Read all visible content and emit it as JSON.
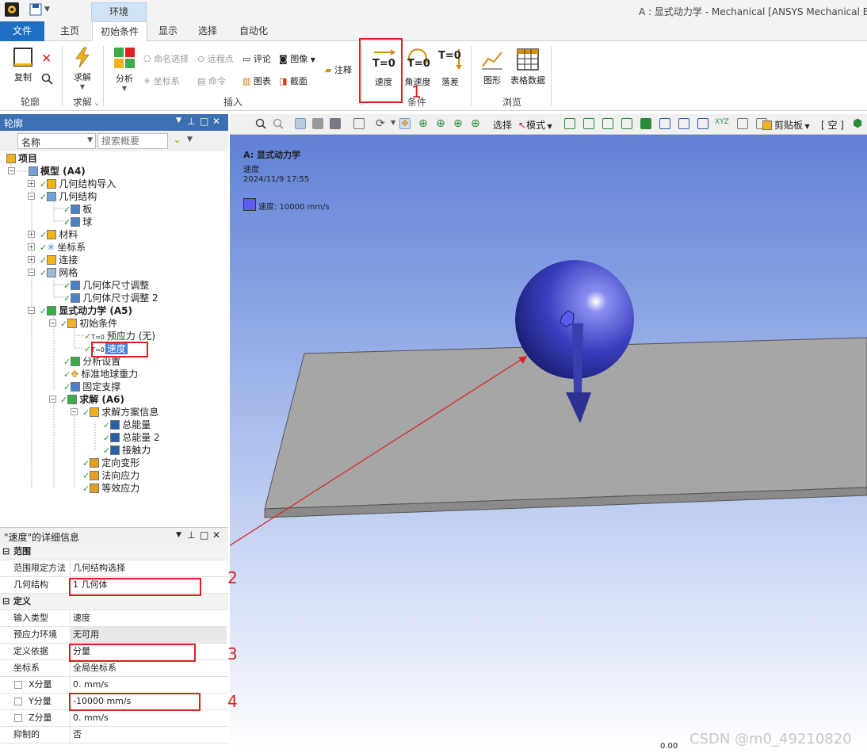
{
  "window": {
    "title": "A : 显式动力学 - Mechanical [ANSYS Mechanical Enterp",
    "context_tab": "环境"
  },
  "tabs": [
    "文件",
    "主页",
    "初始条件",
    "显示",
    "选择",
    "自动化"
  ],
  "ribbon": {
    "outline_group": {
      "copy": "复制",
      "label": "轮廓"
    },
    "solve_group": {
      "solve": "求解",
      "label": "求解"
    },
    "insert_group": {
      "analysis": "分析",
      "named_selection": "命名选择",
      "remote_point": "远程点",
      "comment": "评论",
      "image": "图像",
      "annotation": "注释",
      "coordinate_system": "坐标系",
      "command": "命令",
      "chart": "图表",
      "section": "截面",
      "label": "插入"
    },
    "conditions_group": {
      "velocity": "速度",
      "angular_velocity": "角速度",
      "drop_height": "落差",
      "velocity_icon": "T=0",
      "angular_icon": "T=0",
      "drop_icon": "T=0",
      "label": "条件"
    },
    "browse_group": {
      "graph": "图形",
      "table_data": "表格数据",
      "label": "浏览"
    }
  },
  "outline": {
    "title": "轮廓",
    "filter_name": "名称",
    "search_placeholder": "搜索概要",
    "tree": [
      {
        "label": "项目"
      },
      {
        "label": "模型 (A4)"
      },
      {
        "label": "几何结构导入"
      },
      {
        "label": "几何结构"
      },
      {
        "label": "板"
      },
      {
        "label": "球"
      },
      {
        "label": "材料"
      },
      {
        "label": "坐标系"
      },
      {
        "label": "连接"
      },
      {
        "label": "网格"
      },
      {
        "label": "几何体尺寸调整"
      },
      {
        "label": "几何体尺寸调整 2"
      },
      {
        "label": "显式动力学 (A5)"
      },
      {
        "label": "初始条件"
      },
      {
        "label": "预应力 (无)"
      },
      {
        "label": "速度"
      },
      {
        "label": "分析设置"
      },
      {
        "label": "标准地球重力"
      },
      {
        "label": "固定支撑"
      },
      {
        "label": "求解 (A6)"
      },
      {
        "label": "求解方案信息"
      },
      {
        "label": "总能量"
      },
      {
        "label": "总能量 2"
      },
      {
        "label": "接触力"
      },
      {
        "label": "定向变形"
      },
      {
        "label": "法向应力"
      },
      {
        "label": "等效应力"
      }
    ]
  },
  "details": {
    "title": "\"速度\"的详细信息",
    "rows": [
      {
        "label": "范围",
        "value": ""
      },
      {
        "label": "范围限定方法",
        "value": "几何结构选择"
      },
      {
        "label": "几何结构",
        "value": "1 几何体"
      },
      {
        "label": "定义",
        "value": ""
      },
      {
        "label": "输入类型",
        "value": "速度"
      },
      {
        "label": "预应力环境",
        "value": "无可用"
      },
      {
        "label": "定义依据",
        "value": "分量"
      },
      {
        "label": "坐标系",
        "value": "全局坐标系"
      },
      {
        "label": "X分量",
        "value": "0. mm/s"
      },
      {
        "label": "Y分量",
        "value": "-10000 mm/s"
      },
      {
        "label": "Z分量",
        "value": "0. mm/s"
      },
      {
        "label": "抑制的",
        "value": "否"
      }
    ]
  },
  "viewport": {
    "toolbar": {
      "select": "选择",
      "mode": "模式",
      "clipboard": "剪贴板",
      "empty": "[ 空 ]"
    },
    "header_title": "A: 显式动力学",
    "header_subtitle": "速度",
    "header_time": "2024/11/9 17:55",
    "legend_label": "速度: 10000 mm/s",
    "scale_zero": "0.00",
    "watermark": "CSDN @m0_49210820"
  },
  "annotations": {
    "n1": "1",
    "n2": "2",
    "n3": "3",
    "n4": "4"
  },
  "colors": {
    "accent": "#1d6fc4",
    "highlight": "#e02020",
    "sphere": "#3a3fc0",
    "plate": "#a6a6a6",
    "legend": "#5b5bf0"
  }
}
